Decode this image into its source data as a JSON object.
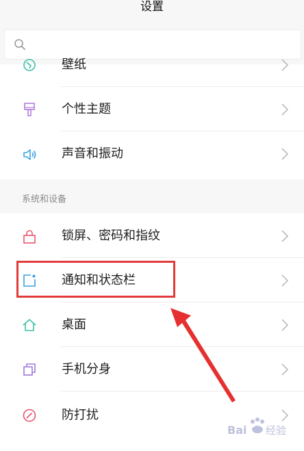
{
  "header": {
    "title": "设置"
  },
  "search": {
    "value": "",
    "placeholder": "",
    "icon": "search-icon"
  },
  "top_section": {
    "items": [
      {
        "label": "壁纸",
        "icon": "wallpaper-icon",
        "color": "#3cc0a8"
      },
      {
        "label": "个性主题",
        "icon": "brush-icon",
        "color": "#b07ddc"
      },
      {
        "label": "声音和振动",
        "icon": "speaker-icon",
        "color": "#3aa4e0"
      }
    ]
  },
  "system_section": {
    "title": "系统和设备",
    "items": [
      {
        "label": "锁屏、密码和指纹",
        "icon": "lock-icon",
        "color": "#e8566e"
      },
      {
        "label": "通知和状态栏",
        "icon": "notification-icon",
        "color": "#3a9ee0"
      },
      {
        "label": "桌面",
        "icon": "home-icon",
        "color": "#3cc0a8"
      },
      {
        "label": "手机分身",
        "icon": "clone-icon",
        "color": "#a07ad8"
      },
      {
        "label": "防打扰",
        "icon": "do-not-disturb-icon",
        "color": "#e8566e"
      }
    ]
  },
  "annotation": {
    "highlight_color": "#e23a3a"
  },
  "watermark": {
    "text": "Bai度经验"
  }
}
